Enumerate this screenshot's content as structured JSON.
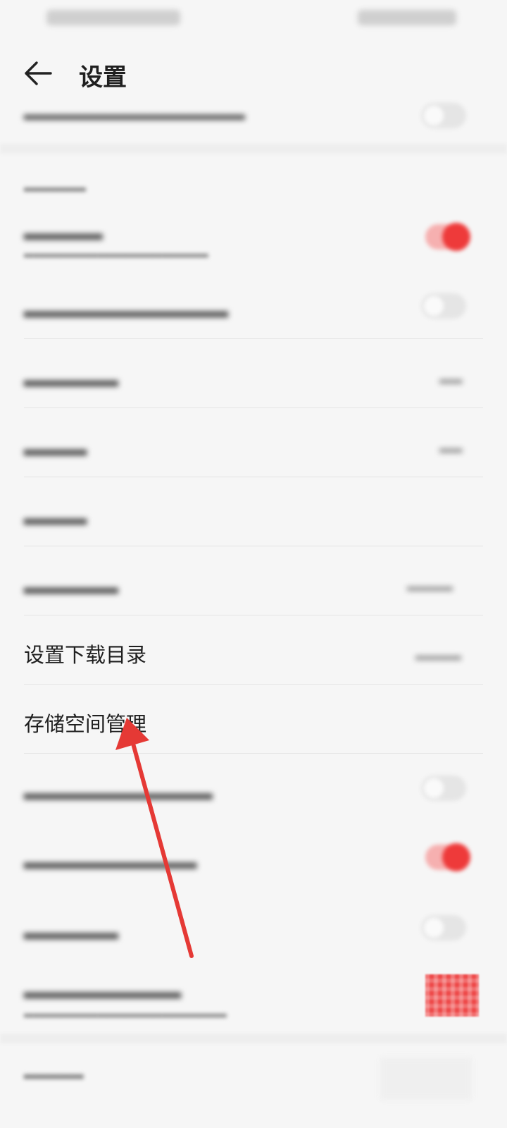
{
  "header": {
    "title": "设置"
  },
  "rows": {
    "download_dir": {
      "label": "设置下载目录"
    },
    "storage": {
      "label": "存储空间管理"
    }
  },
  "colors": {
    "accent": "#ee3a3a",
    "arrow": "#e53935"
  },
  "icons": {
    "back": "back-arrow-icon"
  }
}
